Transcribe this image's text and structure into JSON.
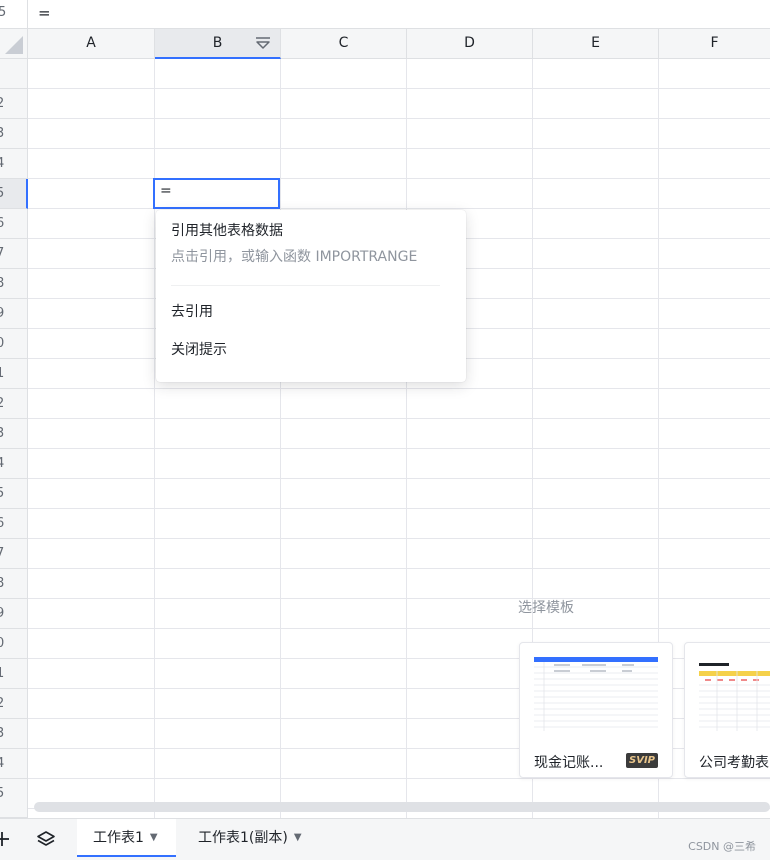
{
  "formula_bar": {
    "cell_ref": "5",
    "content": "="
  },
  "columns": [
    "A",
    "B",
    "C",
    "D",
    "E",
    "F"
  ],
  "rows": [
    "",
    "2",
    "3",
    "4",
    "5",
    "6",
    "7",
    "8",
    "9",
    "0",
    "1",
    "2",
    "3",
    "4",
    "5",
    "6",
    "7",
    "8",
    "9",
    "0",
    "1",
    "2",
    "3",
    "4",
    "5"
  ],
  "active_cell": {
    "value": "="
  },
  "popup": {
    "title": "引用其他表格数据",
    "subtitle": "点击引用，或输入函数 IMPORTRANGE",
    "items": [
      "去引用",
      "关闭提示"
    ]
  },
  "templates": {
    "label": "选择模板",
    "cards": [
      {
        "name": "现金记账...",
        "badge": "SVIP"
      },
      {
        "name": "公司考勤表"
      }
    ]
  },
  "sheet_tabs": [
    {
      "label": "工作表1",
      "active": true
    },
    {
      "label": "工作表1(副本)",
      "active": false
    }
  ],
  "watermark": "CSDN @三希",
  "colors": {
    "accent": "#3370ff",
    "grid": "#e5e6eb",
    "header_bg": "#f5f6f7"
  }
}
